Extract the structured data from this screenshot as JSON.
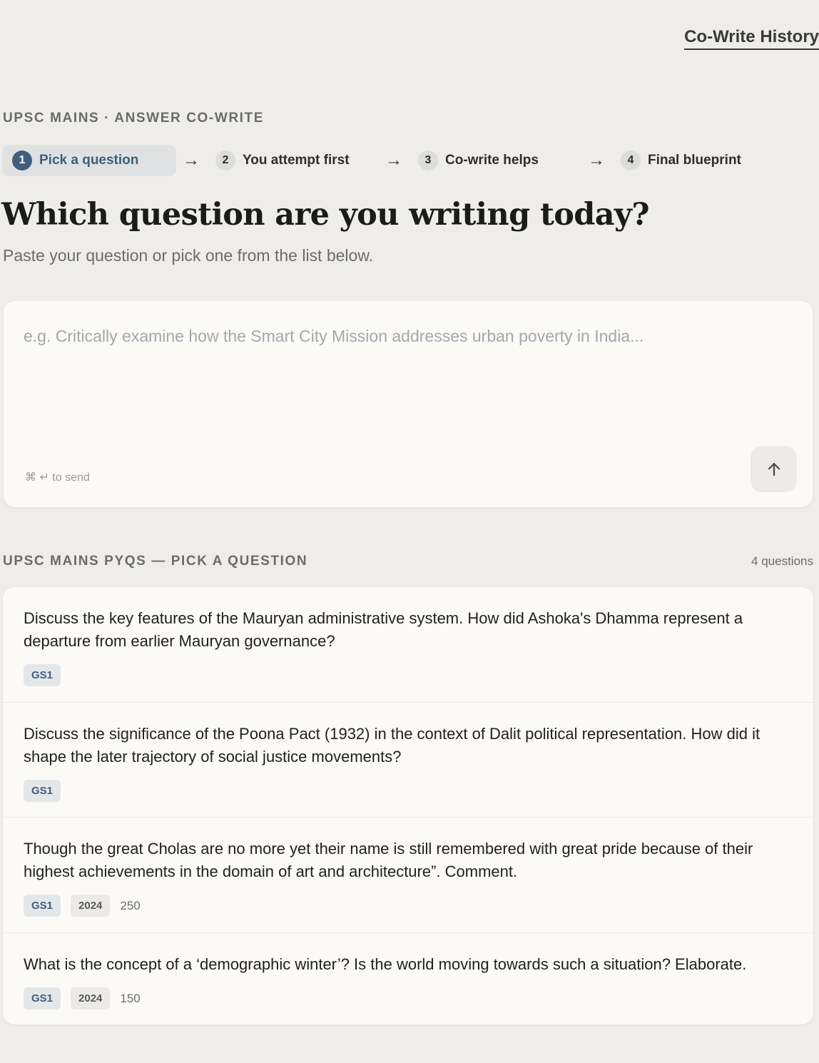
{
  "header": {
    "history_link": "Co-Write History"
  },
  "eyebrow": "UPSC MAINS · ANSWER CO-WRITE",
  "steps": [
    {
      "num": "1",
      "label": "Pick a question"
    },
    {
      "num": "2",
      "label": "You attempt first"
    },
    {
      "num": "3",
      "label": "Co-write helps"
    },
    {
      "num": "4",
      "label": "Final blueprint"
    }
  ],
  "step_arrow": "→",
  "title": "Which question are you writing today?",
  "subtitle": "Paste your question or pick one from the list below.",
  "composer": {
    "placeholder": "e.g. Critically examine how the Smart City Mission addresses urban poverty in India...",
    "send_hint": "⌘ ↵ to send"
  },
  "list": {
    "header": "UPSC MAINS PYQS — PICK A QUESTION",
    "count": "4 questions",
    "questions": [
      {
        "text": "Discuss the key features of the Mauryan administrative system. How did Ashoka's Dhamma represent a departure from earlier Mauryan governance?",
        "paper": "GS1",
        "year": "",
        "marks": ""
      },
      {
        "text": "Discuss the significance of the Poona Pact (1932) in the context of Dalit political representation. How did it shape the later trajectory of social justice movements?",
        "paper": "GS1",
        "year": "",
        "marks": ""
      },
      {
        "text": "Though the great Cholas are no more yet their name is still remembered with great pride because of their highest achievements in the domain of art and architecture”. Comment.",
        "paper": "GS1",
        "year": "2024",
        "marks": "250"
      },
      {
        "text": "What is the concept of a ‘demographic winter’? Is the world moving towards such a situation? Elaborate.",
        "paper": "GS1",
        "year": "2024",
        "marks": "150"
      }
    ]
  }
}
